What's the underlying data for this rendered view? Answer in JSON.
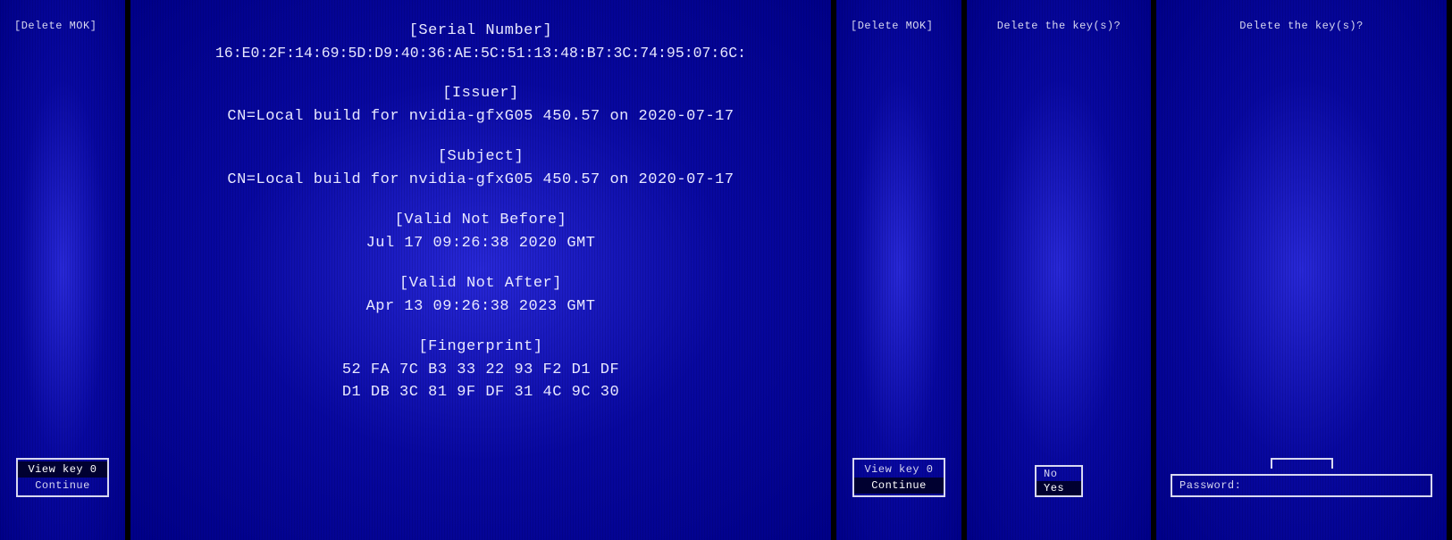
{
  "panels": {
    "p1": {
      "title": "[Delete MOK]",
      "menu": {
        "items": [
          "View key 0",
          "Continue"
        ],
        "selected_index": 0
      }
    },
    "p2": {
      "cert": {
        "serial_label": "[Serial Number]",
        "serial_value": "16:E0:2F:14:69:5D:D9:40:36:AE:5C:51:13:48:B7:3C:74:95:07:6C:",
        "issuer_label": "[Issuer]",
        "issuer_value": "CN=Local build for nvidia-gfxG05 450.57 on 2020-07-17",
        "subject_label": "[Subject]",
        "subject_value": "CN=Local build for nvidia-gfxG05 450.57 on 2020-07-17",
        "not_before_label": "[Valid Not Before]",
        "not_before_value": "Jul 17 09:26:38 2020 GMT",
        "not_after_label": "[Valid Not After]",
        "not_after_value": "Apr 13 09:26:38 2023 GMT",
        "fingerprint_label": "[Fingerprint]",
        "fingerprint_line1": "52 FA 7C B3 33 22 93 F2 D1 DF",
        "fingerprint_line2": "D1 DB 3C 81 9F DF 31 4C 9C 30"
      }
    },
    "p3": {
      "title": "[Delete MOK]",
      "menu": {
        "items": [
          "View key 0",
          "Continue"
        ],
        "selected_index": 1
      }
    },
    "p4": {
      "title": "Delete the key(s)?",
      "menu": {
        "items": [
          "No",
          "Yes"
        ],
        "selected_index": 1
      }
    },
    "p5": {
      "title": "Delete the key(s)?",
      "password_label": "Password:"
    }
  }
}
